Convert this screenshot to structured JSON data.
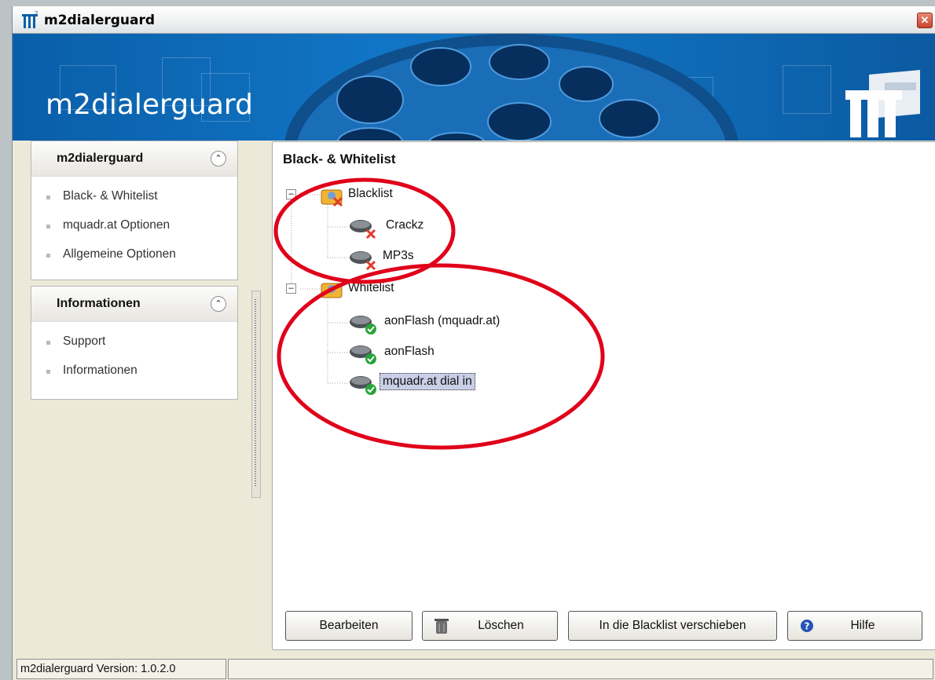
{
  "window": {
    "title": "m2dialerguard",
    "close_icon": "close-icon"
  },
  "banner": {
    "app_title": "m2dialerguard"
  },
  "sidebar": {
    "panels": [
      {
        "title": "m2dialerguard",
        "items": [
          "Black- & Whitelist",
          "mquadr.at Optionen",
          "Allgemeine Optionen"
        ]
      },
      {
        "title": "Informationen",
        "items": [
          "Support",
          "Informationen"
        ]
      }
    ]
  },
  "main": {
    "heading": "Black- & Whitelist",
    "tree": {
      "blacklist": {
        "label": "Blacklist",
        "expander": "–",
        "children": [
          "Crackz",
          "MP3s"
        ]
      },
      "whitelist": {
        "label": "Whitelist",
        "expander": "–",
        "children": [
          "aonFlash (mquadr.at)",
          "aonFlash",
          "mquadr.at dial in"
        ]
      },
      "selected_item": "mquadr.at dial in"
    },
    "buttons": {
      "edit": "Bearbeiten",
      "delete": "Löschen",
      "move": "In die Blacklist verschieben",
      "help": "Hilfe"
    }
  },
  "statusbar": {
    "version": "m2dialerguard Version:  1.0.2.0"
  },
  "colors": {
    "banner": "#1175c5",
    "annotation": "#e0001a",
    "accent": "#0a5ea8"
  }
}
